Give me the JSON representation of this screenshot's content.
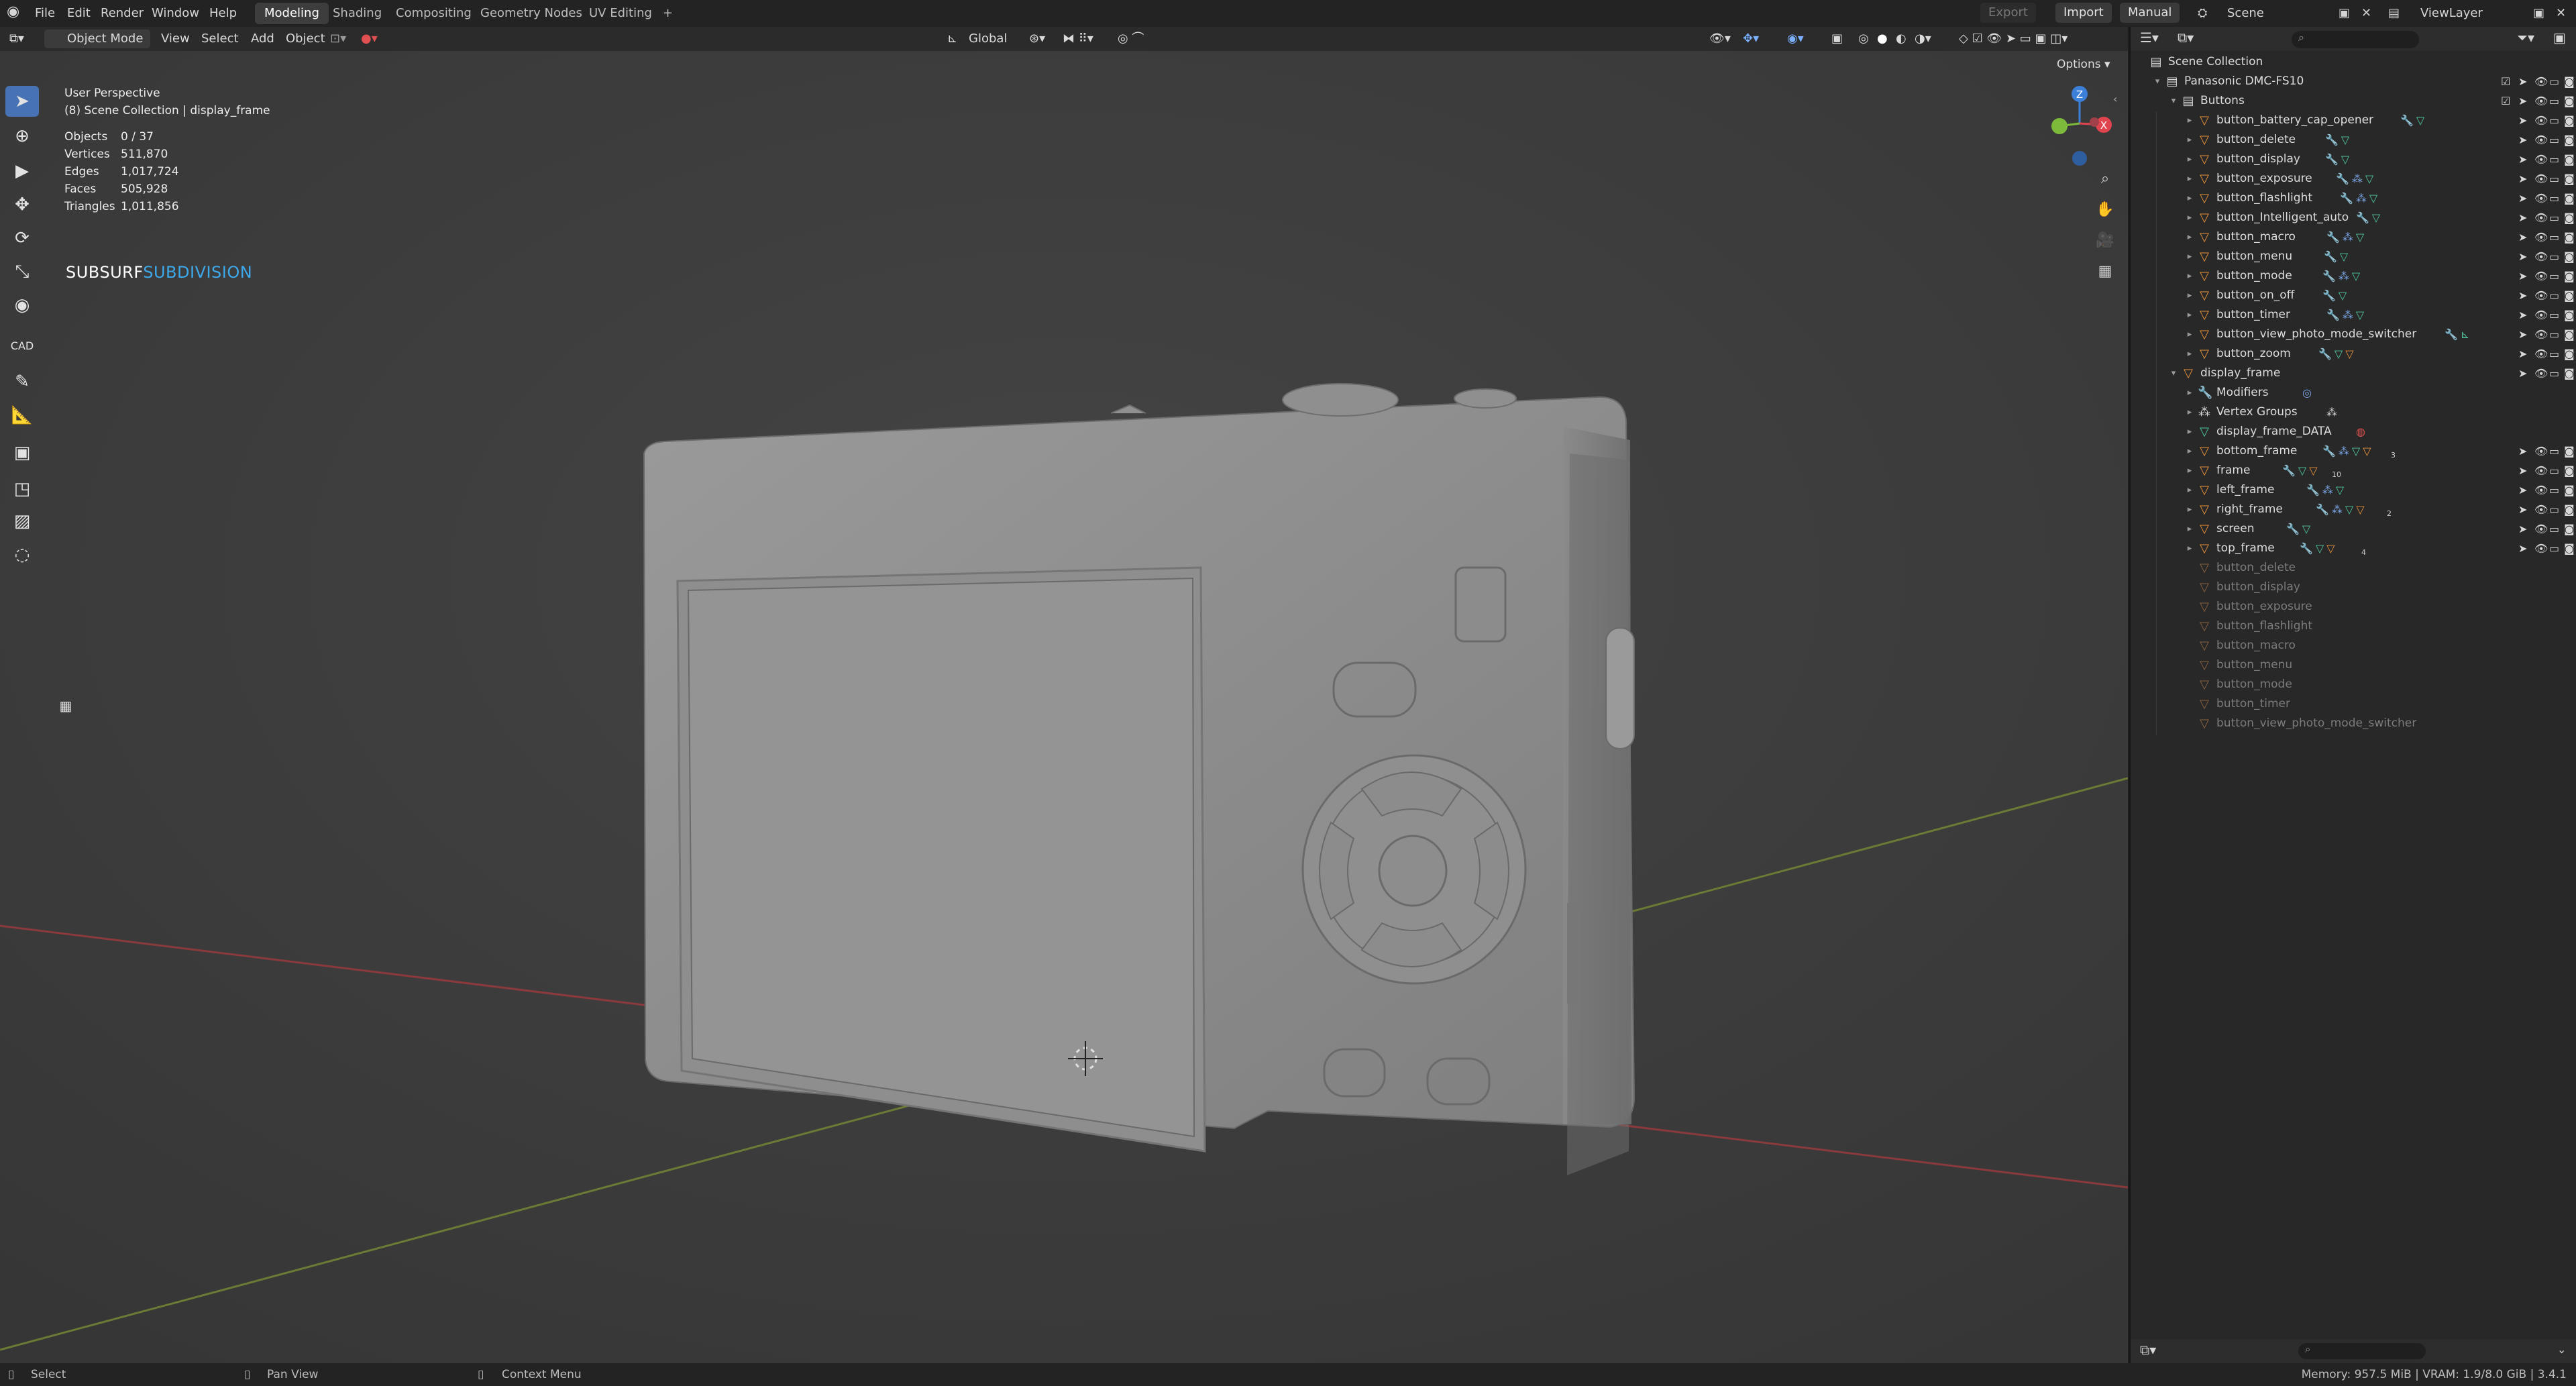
{
  "topbar": {
    "menus": [
      "File",
      "Edit",
      "Render",
      "Window",
      "Help"
    ],
    "workspaces": [
      "Modeling",
      "Shading",
      "Compositing",
      "Geometry Nodes",
      "UV Editing"
    ],
    "active_workspace": "Modeling",
    "add_workspace": "+",
    "export_label": "Export",
    "import_label": "Import",
    "manual_label": "Manual",
    "scene_label": "Scene",
    "viewlayer_label": "ViewLayer"
  },
  "viewport_header": {
    "mode": "Object Mode",
    "menus": [
      "View",
      "Select",
      "Add",
      "Object"
    ],
    "transform_orientation": "Global",
    "options_label": "Options"
  },
  "overlay": {
    "view_name": "User Perspective",
    "collection_info": "(8) Scene Collection | display_frame",
    "stats": [
      {
        "label": "Objects",
        "value": "0 / 37"
      },
      {
        "label": "Vertices",
        "value": "511,870"
      },
      {
        "label": "Edges",
        "value": "1,017,724"
      },
      {
        "label": "Faces",
        "value": "505,928"
      },
      {
        "label": "Triangles",
        "value": "1,011,856"
      }
    ],
    "subsurf_a": "SUBSURF",
    "subsurf_b": "SUBDIVISION"
  },
  "gizmo": {
    "z": "Z",
    "x": "X"
  },
  "outliner": {
    "rows": [
      {
        "label": "Scene Collection"
      },
      {
        "label": "Panasonic DMC-FS10"
      },
      {
        "label": "Buttons"
      },
      {
        "label": "button_battery_cap_opener"
      },
      {
        "label": "button_delete"
      },
      {
        "label": "button_display"
      },
      {
        "label": "button_exposure"
      },
      {
        "label": "button_flashlight"
      },
      {
        "label": "button_Intelligent_auto"
      },
      {
        "label": "button_macro"
      },
      {
        "label": "button_menu"
      },
      {
        "label": "button_mode"
      },
      {
        "label": "button_on_off"
      },
      {
        "label": "button_timer"
      },
      {
        "label": "button_view_photo_mode_switcher"
      },
      {
        "label": "button_zoom"
      },
      {
        "label": "display_frame"
      },
      {
        "label": "Modifiers"
      },
      {
        "label": "Vertex Groups"
      },
      {
        "label": "display_frame_DATA"
      },
      {
        "label": "bottom_frame"
      },
      {
        "label": "frame"
      },
      {
        "label": "left_frame"
      },
      {
        "label": "right_frame"
      },
      {
        "label": "screen"
      },
      {
        "label": "top_frame"
      },
      {
        "label": "button_delete"
      },
      {
        "label": "button_display"
      },
      {
        "label": "button_exposure"
      },
      {
        "label": "button_flashlight"
      },
      {
        "label": "button_macro"
      },
      {
        "label": "button_menu"
      },
      {
        "label": "button_mode"
      },
      {
        "label": "button_timer"
      },
      {
        "label": "button_view_photo_mode_switcher"
      }
    ],
    "badges": {
      "frame": "10",
      "bottom_frame": "3",
      "right_frame": "2",
      "top_frame": "4"
    }
  },
  "statusbar": {
    "select": "Select",
    "pan_view": "Pan View",
    "context_menu": "Context Menu",
    "memory": "Memory: 957.5 MiB | VRAM: 1.9/8.0 GiB | 3.4.1"
  },
  "colors": {
    "accent": "#4772b3",
    "subsurf_blue": "#3da8ea",
    "x_axis": "#e0454f",
    "y_axis": "#7dba3c",
    "z_axis": "#3b7fd8",
    "mesh_gray": "#8c8c8c"
  }
}
